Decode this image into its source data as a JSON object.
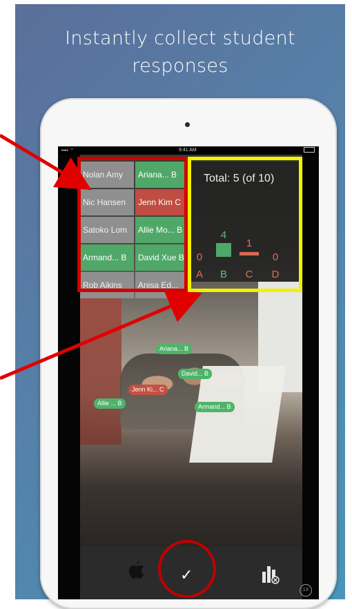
{
  "headline": {
    "line1": "Instantly collect student",
    "line2": "responses"
  },
  "status_bar": {
    "carrier": "•••• ⌔",
    "time": "9:41 AM"
  },
  "roster": [
    {
      "name": "Nolan Amy",
      "state": "gray"
    },
    {
      "name": "Ariana...  B",
      "state": "green"
    },
    {
      "name": "Nic Hansen",
      "state": "gray"
    },
    {
      "name": "Jenn Kim  C",
      "state": "red"
    },
    {
      "name": "Satoko Lom",
      "state": "gray"
    },
    {
      "name": "Allie Mo...  B",
      "state": "green"
    },
    {
      "name": "Armand...  B",
      "state": "green"
    },
    {
      "name": "David Xue B",
      "state": "green"
    },
    {
      "name": "Rob Aikins",
      "state": "gray"
    },
    {
      "name": "Anisa Ed...",
      "state": "gray"
    }
  ],
  "summary": {
    "total_label": "Total: 5 (of 10)",
    "answers": [
      {
        "letter": "A",
        "count": "0"
      },
      {
        "letter": "B",
        "count": "4"
      },
      {
        "letter": "C",
        "count": "1"
      },
      {
        "letter": "D",
        "count": "0"
      }
    ]
  },
  "photo_tags": [
    {
      "label": "Ariana...  B",
      "color": "green"
    },
    {
      "label": "David...  B",
      "color": "green"
    },
    {
      "label": "Jenn Ki...  C",
      "color": "red"
    },
    {
      "label": "Allie ...  B",
      "color": "green"
    },
    {
      "label": "Armand...  B",
      "color": "green"
    }
  ],
  "zoom_label": "1X",
  "colors": {
    "correct": "#4fa867",
    "incorrect": "#c04d42",
    "annotation_red": "#d40000",
    "annotation_yellow": "#f2f200",
    "background": "#5680a8"
  },
  "icons": {
    "apple": "apple-logo-icon",
    "confirm": "checkmark-icon",
    "results": "bar-chart-icon"
  }
}
